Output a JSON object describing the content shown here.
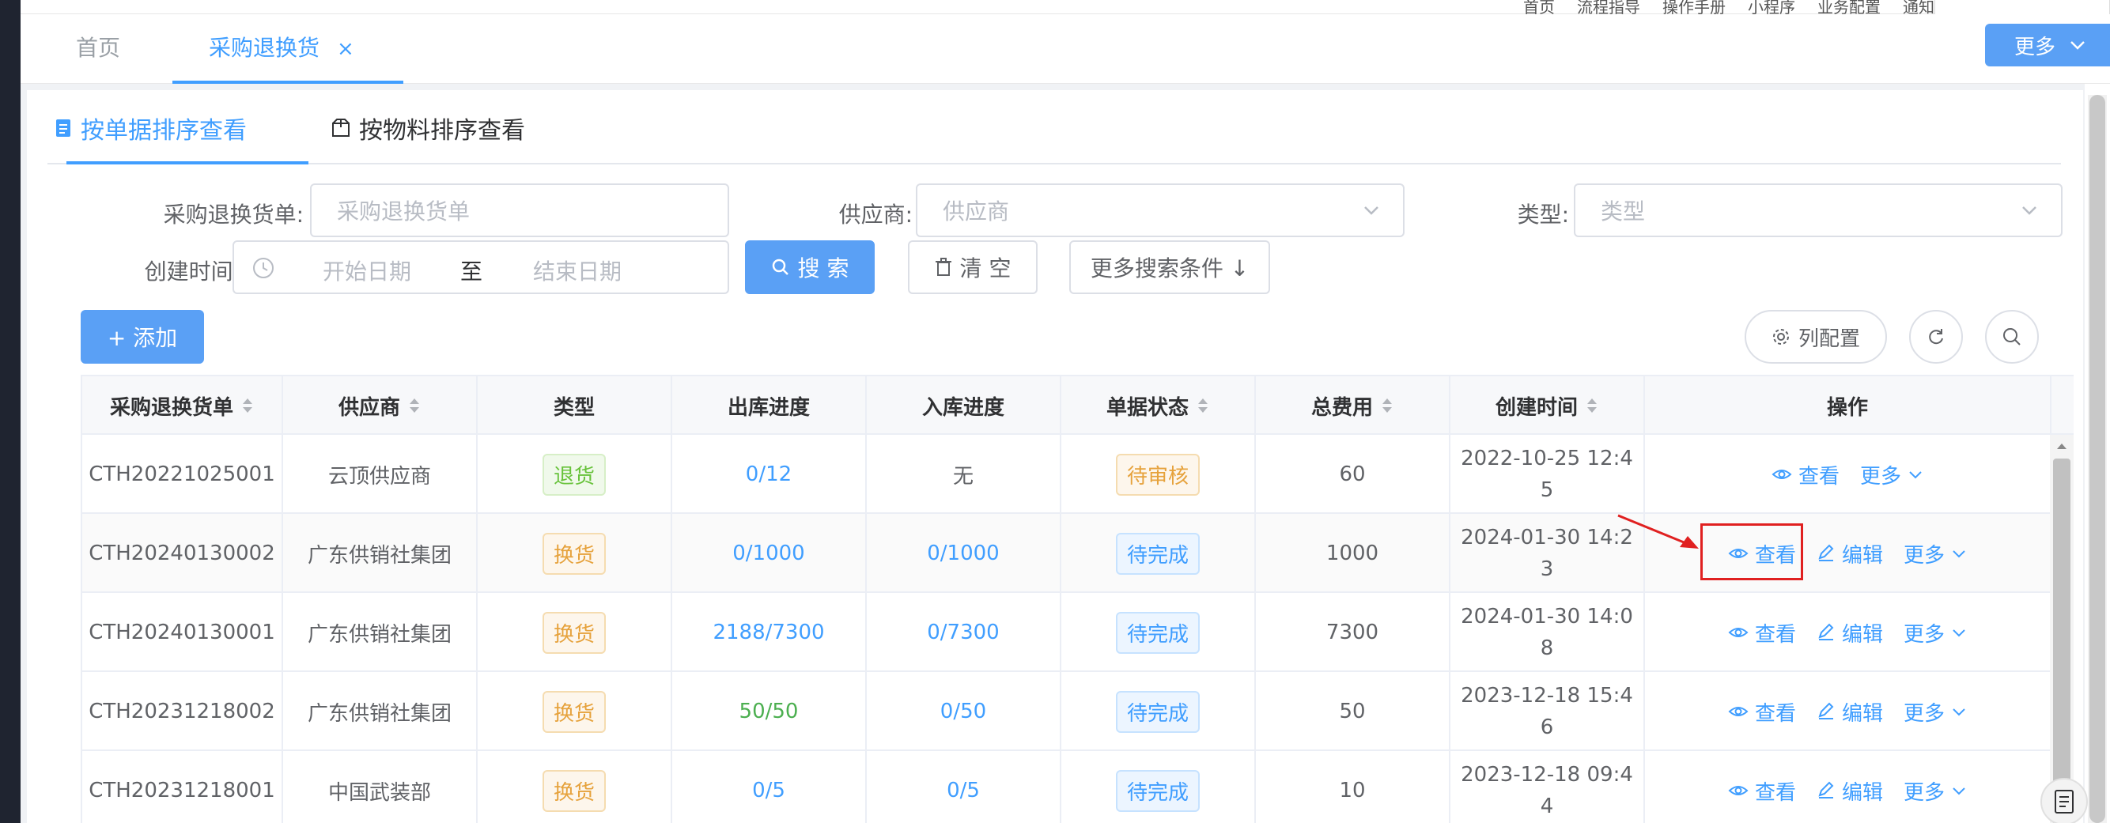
{
  "topnav": {
    "links": [
      "首页",
      "流程指导",
      "操作手册",
      "小程序",
      "业务配置",
      "通知"
    ]
  },
  "tabs": {
    "home": "首页",
    "active": "采购退换货",
    "close_glyph": "×",
    "more_label": "更多"
  },
  "subtabs": [
    "按单据排序查看",
    "按物料排序查看"
  ],
  "filters": {
    "order_no": {
      "label": "采购退换货单:",
      "placeholder": "采购退换货单"
    },
    "supplier": {
      "label": "供应商:",
      "placeholder": "供应商"
    },
    "type": {
      "label": "类型:",
      "placeholder": "类型"
    },
    "create_time": {
      "label": "创建时间:",
      "start_placeholder": "开始日期",
      "separator": "至",
      "end_placeholder": "结束日期"
    }
  },
  "buttons": {
    "search": "搜 索",
    "clear": "清 空",
    "more_conditions": "更多搜索条件 ↓",
    "add": "+ 添加",
    "column_config": "列配置"
  },
  "colors": {
    "primary": "#409eff",
    "primary_button": "#5aa0f5",
    "tag_return": "#67c23a",
    "tag_exchange": "#e6a23c",
    "annotation": "#e02020"
  },
  "table": {
    "columns": [
      {
        "key": "order_no",
        "label": "采购退换货单",
        "sortable": true
      },
      {
        "key": "supplier",
        "label": "供应商",
        "sortable": true
      },
      {
        "key": "type",
        "label": "类型",
        "sortable": false
      },
      {
        "key": "out_progress",
        "label": "出库进度",
        "sortable": false
      },
      {
        "key": "in_progress",
        "label": "入库进度",
        "sortable": false
      },
      {
        "key": "status",
        "label": "单据状态",
        "sortable": true
      },
      {
        "key": "total",
        "label": "总费用",
        "sortable": true
      },
      {
        "key": "created",
        "label": "创建时间",
        "sortable": true
      },
      {
        "key": "ops",
        "label": "操作",
        "sortable": false
      }
    ],
    "actions": {
      "view": "查看",
      "edit": "编辑",
      "more": "更多"
    },
    "rows": [
      {
        "order_no": "CTH20221025001",
        "supplier": "云顶供应商",
        "type": "退货",
        "type_kind": "return",
        "out_progress": "0/12",
        "out_color": "link",
        "in_progress": "无",
        "in_color": "plain",
        "status": "待审核",
        "status_kind": "pending-review",
        "total": "60",
        "created": "2022-10-25 12:45",
        "editable": false
      },
      {
        "order_no": "CTH20240130002",
        "supplier": "广东供销社集团",
        "type": "换货",
        "type_kind": "exchange",
        "out_progress": "0/1000",
        "out_color": "link",
        "in_progress": "0/1000",
        "in_color": "link",
        "status": "待完成",
        "status_kind": "pending-done",
        "total": "1000",
        "created": "2024-01-30 14:23",
        "editable": true
      },
      {
        "order_no": "CTH20240130001",
        "supplier": "广东供销社集团",
        "type": "换货",
        "type_kind": "exchange",
        "out_progress": "2188/7300",
        "out_color": "link",
        "in_progress": "0/7300",
        "in_color": "link",
        "status": "待完成",
        "status_kind": "pending-done",
        "total": "7300",
        "created": "2024-01-30 14:08",
        "editable": true
      },
      {
        "order_no": "CTH20231218002",
        "supplier": "广东供销社集团",
        "type": "换货",
        "type_kind": "exchange",
        "out_progress": "50/50",
        "out_color": "green",
        "in_progress": "0/50",
        "in_color": "link",
        "status": "待完成",
        "status_kind": "pending-done",
        "total": "50",
        "created": "2023-12-18 15:46",
        "editable": true
      },
      {
        "order_no": "CTH20231218001",
        "supplier": "中国武装部",
        "type": "换货",
        "type_kind": "exchange",
        "out_progress": "0/5",
        "out_color": "link",
        "in_progress": "0/5",
        "in_color": "link",
        "status": "待完成",
        "status_kind": "pending-done",
        "total": "10",
        "created": "2023-12-18 09:44",
        "editable": true
      }
    ]
  }
}
